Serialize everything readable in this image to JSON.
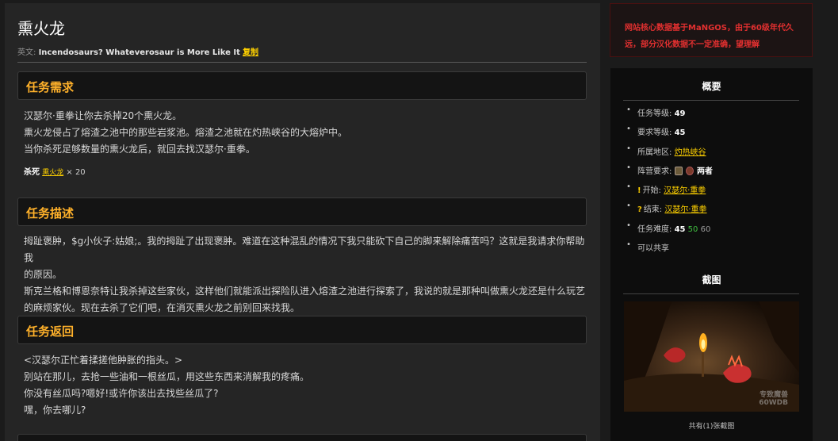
{
  "quest": {
    "title": "熏火龙",
    "en_label": "英文:",
    "en_name": "Incendosaurs? Whateverosaur is More Like It",
    "copy_label": "复制"
  },
  "requirements": {
    "heading": "任务需求",
    "lines": [
      "汉瑟尔·重拳让你去杀掉20个熏火龙。",
      "熏火龙侵占了熔渣之池中的那些岩浆池。熔渣之池就在灼热峡谷的大熔炉中。",
      "当你杀死足够数量的熏火龙后，就回去找汉瑟尔·重拳。"
    ],
    "kill_label": "杀死",
    "kill_target": "熏火龙",
    "kill_times": "× 20"
  },
  "description": {
    "heading": "任务描述",
    "lines": [
      "拇趾褒肿，$g小伙子:姑娘;。我的拇趾了出现褒肿。难道在这种混乱的情况下我只能砍下自己的脚来解除痛苦吗？这就是我请求你帮助我",
      "的原因。",
      "斯克兰格和博恩奈特让我杀掉这些家伙，这样他们就能派出探险队进入熔渣之池进行探索了，我说的就是那种叫做熏火龙还是什么玩艺",
      "的麻烦家伙。现在去杀了它们吧，在消灭熏火龙之前别回来找我。"
    ]
  },
  "return": {
    "heading": "任务返回",
    "lines": [
      "<汉瑟尔正忙着揉搓他肿胀的指头。>",
      "别站在那儿，去抢一些油和一根丝瓜，用这些东西来消解我的疼痛。",
      "你没有丝瓜吗?嗯好!或许你该出去找些丝瓜了?",
      "嘿，你去哪儿?"
    ]
  },
  "notice": {
    "text": "网站核心数据基于MaNGOS，由于60级年代久远，部分汉化数据不一定准确，望理解"
  },
  "overview": {
    "title": "概要",
    "level_label": "任务等级:",
    "level_value": "49",
    "req_level_label": "要求等级:",
    "req_level_value": "45",
    "zone_label": "所属地区:",
    "zone_value": "灼热峡谷",
    "faction_label": "阵营要求:",
    "faction_value": "两者",
    "start_label": "开始:",
    "start_npc": "汉瑟尔·重拳",
    "end_label": "结束:",
    "end_npc": "汉瑟尔·重拳",
    "difficulty_label": "任务难度:",
    "difficulty": [
      "45",
      "50",
      "60"
    ],
    "shareable": "可以共享"
  },
  "screenshots": {
    "title": "截图",
    "watermark_top": "专致魔兽",
    "watermark_bottom": "60WDB",
    "caption": "共有(1)张截图"
  },
  "colors": {
    "heading": "#ffb12a",
    "link": "#ffd100",
    "notice": "#e23030",
    "difficulty_green": "#40bf40"
  },
  "icons": [
    "alliance-icon",
    "horde-icon",
    "quest-start-icon",
    "quest-end-icon"
  ]
}
